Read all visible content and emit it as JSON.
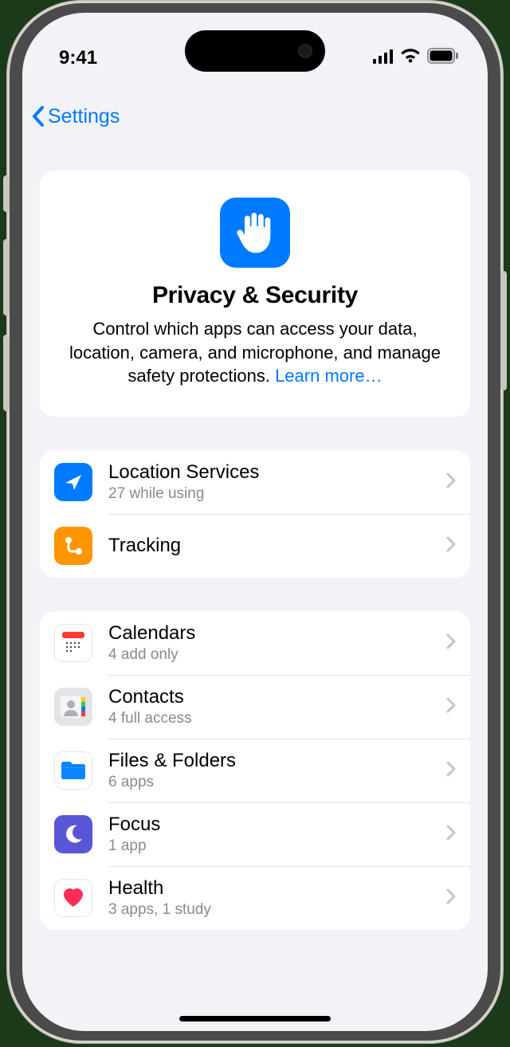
{
  "status": {
    "time": "9:41"
  },
  "nav": {
    "back_label": "Settings"
  },
  "header": {
    "title": "Privacy & Security",
    "body": "Control which apps can access your data, location, camera, and microphone, and manage safety protections. ",
    "learn_more": "Learn more…"
  },
  "group1": [
    {
      "title": "Location Services",
      "detail": "27 while using"
    },
    {
      "title": "Tracking",
      "detail": ""
    }
  ],
  "group2": [
    {
      "title": "Calendars",
      "detail": "4 add only"
    },
    {
      "title": "Contacts",
      "detail": "4 full access"
    },
    {
      "title": "Files & Folders",
      "detail": "6 apps"
    },
    {
      "title": "Focus",
      "detail": "1 app"
    },
    {
      "title": "Health",
      "detail": "3 apps, 1 study"
    }
  ]
}
